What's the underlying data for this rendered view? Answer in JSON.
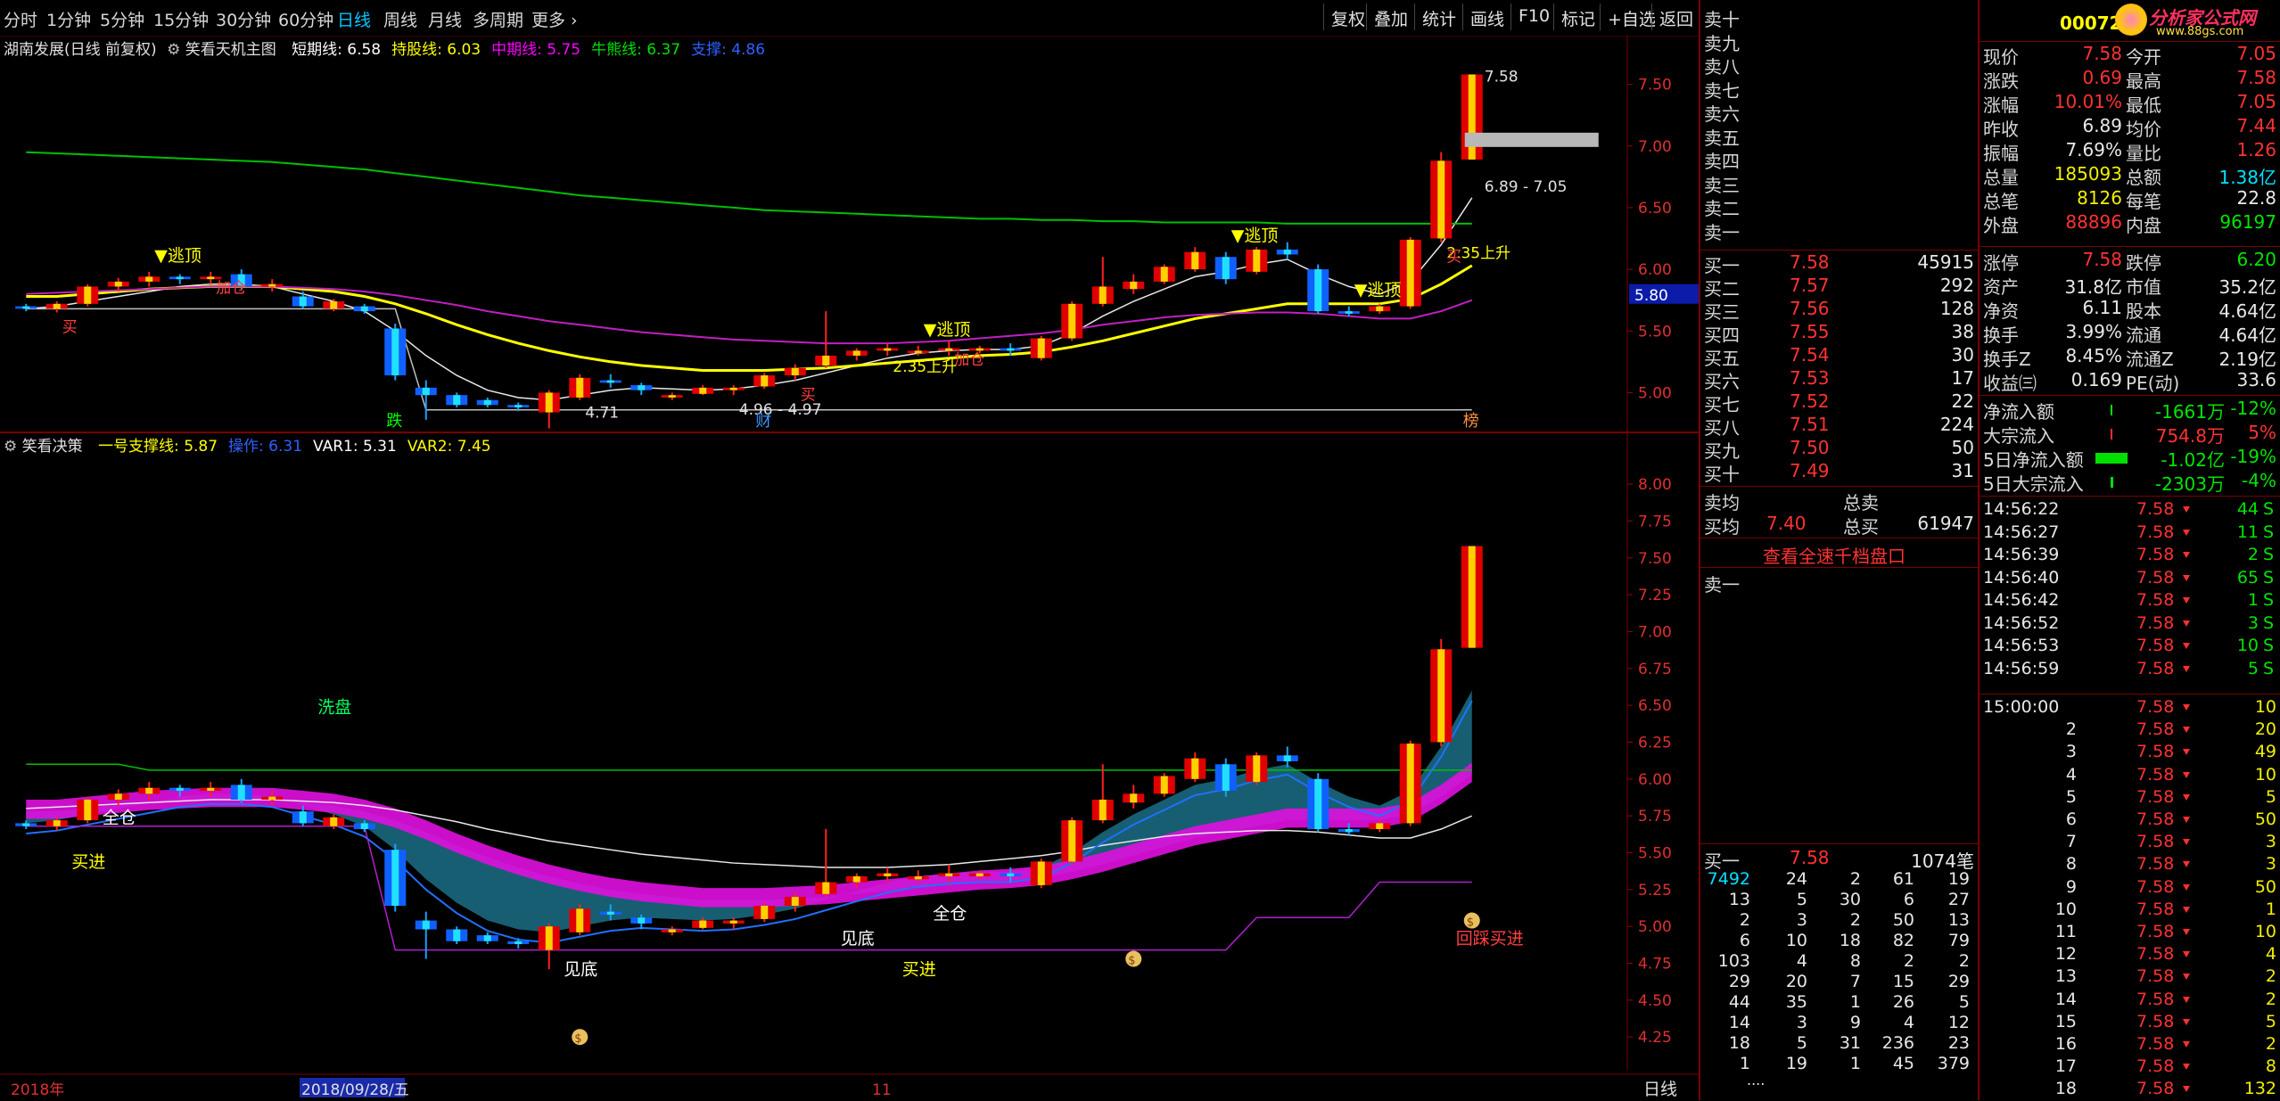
{
  "toolbar": {
    "periods": [
      "分时",
      "1分钟",
      "5分钟",
      "15分钟",
      "30分钟",
      "60分钟",
      "日线",
      "周线",
      "月线",
      "多周期",
      "更多"
    ],
    "active_period": "日线",
    "buttons": [
      "复权",
      "叠加",
      "统计",
      "画线",
      "F10",
      "标记",
      "+自选",
      "返回"
    ]
  },
  "main_legend": {
    "stock": "湖南发展(日线 前复权)",
    "indicator": "笑看天机主图",
    "items": [
      {
        "label": "短期线: 6.58",
        "color": "#ffffff"
      },
      {
        "label": "持股线: 6.03",
        "color": "#ffff00"
      },
      {
        "label": "中期线: 5.75",
        "color": "#ff00ff"
      },
      {
        "label": "牛熊线: 6.37",
        "color": "#00e000"
      },
      {
        "label": "支撑: 4.86",
        "color": "#3060ff"
      }
    ]
  },
  "sub_legend": {
    "indicator": "笑看决策",
    "items": [
      {
        "label": "一号支撑线: 5.87",
        "color": "#ffff00"
      },
      {
        "label": "操作: 6.31",
        "color": "#3060ff"
      },
      {
        "label": "VAR1: 5.31",
        "color": "#ffffff"
      },
      {
        "label": "VAR2: 7.45",
        "color": "#ffff00"
      }
    ]
  },
  "chart_data": [
    {
      "type": "candlestick",
      "title": "湖南发展(日线 前复权)",
      "ylim": [
        4.75,
        7.75
      ],
      "y_ticks": [
        "7.50",
        "7.00",
        "6.50",
        "6.00",
        "5.50",
        "5.00"
      ],
      "price_tag": "5.80",
      "candles": [
        [
          5.7,
          5.72,
          5.66,
          5.68
        ],
        [
          5.68,
          5.74,
          5.65,
          5.72
        ],
        [
          5.72,
          5.88,
          5.7,
          5.86
        ],
        [
          5.86,
          5.93,
          5.82,
          5.9
        ],
        [
          5.9,
          5.98,
          5.86,
          5.94
        ],
        [
          5.94,
          5.96,
          5.88,
          5.92
        ],
        [
          5.92,
          5.98,
          5.88,
          5.94
        ],
        [
          5.96,
          6.0,
          5.84,
          5.86
        ],
        [
          5.86,
          5.92,
          5.82,
          5.88
        ],
        [
          5.78,
          5.82,
          5.68,
          5.7
        ],
        [
          5.68,
          5.76,
          5.66,
          5.74
        ],
        [
          5.7,
          5.72,
          5.64,
          5.66
        ],
        [
          5.52,
          5.56,
          5.1,
          5.14
        ],
        [
          5.04,
          5.1,
          4.78,
          4.98
        ],
        [
          4.98,
          5.0,
          4.88,
          4.9
        ],
        [
          4.94,
          4.96,
          4.88,
          4.9
        ],
        [
          4.9,
          4.92,
          4.85,
          4.88
        ],
        [
          4.84,
          5.02,
          4.71,
          5.0
        ],
        [
          4.96,
          5.15,
          4.94,
          5.12
        ],
        [
          5.1,
          5.15,
          5.04,
          5.08
        ],
        [
          5.06,
          5.08,
          4.98,
          5.02
        ],
        [
          4.96,
          5.0,
          4.94,
          4.98
        ],
        [
          4.99,
          5.06,
          4.98,
          5.04
        ],
        [
          5.02,
          5.06,
          4.98,
          5.04
        ],
        [
          5.05,
          5.16,
          5.03,
          5.14
        ],
        [
          5.14,
          5.23,
          5.1,
          5.2
        ],
        [
          5.22,
          5.66,
          5.2,
          5.3
        ],
        [
          5.3,
          5.36,
          5.26,
          5.34
        ],
        [
          5.34,
          5.4,
          5.3,
          5.36
        ],
        [
          5.32,
          5.38,
          5.3,
          5.34
        ],
        [
          5.34,
          5.42,
          5.3,
          5.36
        ],
        [
          5.34,
          5.38,
          5.32,
          5.36
        ],
        [
          5.36,
          5.4,
          5.3,
          5.34
        ],
        [
          5.28,
          5.46,
          5.26,
          5.44
        ],
        [
          5.44,
          5.74,
          5.42,
          5.72
        ],
        [
          5.72,
          6.1,
          5.7,
          5.86
        ],
        [
          5.84,
          5.96,
          5.8,
          5.9
        ],
        [
          5.9,
          6.04,
          5.88,
          6.02
        ],
        [
          6.0,
          6.18,
          5.98,
          6.14
        ],
        [
          6.1,
          6.14,
          5.88,
          5.92
        ],
        [
          5.98,
          6.18,
          5.96,
          6.16
        ],
        [
          6.16,
          6.22,
          6.08,
          6.12
        ],
        [
          6.0,
          6.04,
          5.64,
          5.66
        ],
        [
          5.66,
          5.7,
          5.62,
          5.64
        ],
        [
          5.66,
          5.72,
          5.64,
          5.7
        ],
        [
          5.7,
          6.26,
          5.68,
          6.24
        ],
        [
          6.25,
          6.95,
          6.22,
          6.88
        ],
        [
          6.89,
          7.58,
          6.89,
          7.58
        ]
      ],
      "lines": {
        "短期线": [
          5.68,
          5.7,
          5.74,
          5.78,
          5.82,
          5.86,
          5.88,
          5.88,
          5.86,
          5.8,
          5.74,
          5.66,
          5.5,
          5.3,
          5.14,
          5.02,
          4.96,
          4.94,
          4.98,
          5.02,
          5.04,
          5.03,
          5.02,
          5.03,
          5.06,
          5.1,
          5.16,
          5.22,
          5.28,
          5.32,
          5.34,
          5.35,
          5.35,
          5.38,
          5.48,
          5.62,
          5.74,
          5.84,
          5.94,
          5.98,
          6.04,
          6.08,
          5.96,
          5.86,
          5.8,
          5.9,
          6.2,
          6.58
        ],
        "持股线": [
          5.78,
          5.78,
          5.8,
          5.82,
          5.84,
          5.85,
          5.86,
          5.86,
          5.86,
          5.84,
          5.82,
          5.78,
          5.72,
          5.64,
          5.55,
          5.47,
          5.4,
          5.34,
          5.29,
          5.25,
          5.22,
          5.2,
          5.18,
          5.18,
          5.18,
          5.19,
          5.2,
          5.22,
          5.24,
          5.26,
          5.28,
          5.3,
          5.31,
          5.33,
          5.37,
          5.42,
          5.48,
          5.54,
          5.6,
          5.64,
          5.68,
          5.72,
          5.72,
          5.72,
          5.72,
          5.76,
          5.88,
          6.03
        ],
        "中期线": [
          5.8,
          5.81,
          5.82,
          5.83,
          5.84,
          5.85,
          5.86,
          5.86,
          5.86,
          5.85,
          5.84,
          5.82,
          5.79,
          5.75,
          5.71,
          5.66,
          5.62,
          5.58,
          5.55,
          5.52,
          5.49,
          5.47,
          5.45,
          5.43,
          5.42,
          5.41,
          5.4,
          5.4,
          5.4,
          5.41,
          5.42,
          5.44,
          5.46,
          5.48,
          5.51,
          5.55,
          5.58,
          5.61,
          5.63,
          5.64,
          5.65,
          5.65,
          5.64,
          5.62,
          5.6,
          5.6,
          5.66,
          5.75
        ],
        "牛熊线": [
          6.95,
          6.94,
          6.93,
          6.92,
          6.91,
          6.9,
          6.89,
          6.88,
          6.87,
          6.85,
          6.83,
          6.81,
          6.78,
          6.75,
          6.72,
          6.69,
          6.66,
          6.63,
          6.6,
          6.58,
          6.56,
          6.54,
          6.52,
          6.5,
          6.48,
          6.47,
          6.46,
          6.45,
          6.44,
          6.43,
          6.42,
          6.41,
          6.41,
          6.4,
          6.4,
          6.39,
          6.39,
          6.38,
          6.38,
          6.38,
          6.38,
          6.37,
          6.37,
          6.37,
          6.37,
          6.37,
          6.37,
          6.37
        ],
        "支撑": [
          5.68,
          5.68,
          5.68,
          5.68,
          5.68,
          5.68,
          5.68,
          5.68,
          5.68,
          5.68,
          5.68,
          5.68,
          5.68,
          4.86,
          4.86,
          4.86,
          4.86,
          4.86,
          4.86,
          4.86,
          4.86,
          4.86,
          4.86,
          4.86,
          4.86,
          4.86,
          4.86,
          4.86,
          4.86,
          4.86,
          4.86,
          4.86,
          4.86,
          4.86,
          4.86,
          4.86,
          4.86,
          4.86,
          4.86,
          4.86,
          4.86,
          4.86,
          4.86,
          4.86,
          4.86,
          4.86,
          4.86,
          4.86
        ]
      },
      "annotations": [
        {
          "i": 4,
          "text": "▼逃顶",
          "color": "#ffff00"
        },
        {
          "i": 1,
          "text": "买",
          "color": "#ff4040"
        },
        {
          "i": 6,
          "text": "加仓",
          "color": "#ff4040"
        },
        {
          "i": 29,
          "text": "▼逃顶",
          "color": "#ffff00"
        },
        {
          "i": 39,
          "text": "▼逃顶",
          "color": "#ffff00"
        },
        {
          "i": 43,
          "text": "▼逃顶",
          "color": "#ffff00"
        },
        {
          "i": 30,
          "text": "加仓",
          "color": "#ff4040"
        },
        {
          "i": 28,
          "text": "2.35上升",
          "color": "#ffff00"
        },
        {
          "i": 25,
          "text": "买",
          "color": "#ff4040"
        },
        {
          "i": 46,
          "text": "2.35上升",
          "color": "#ffff00"
        },
        {
          "i": 46,
          "text": "买",
          "color": "#ff4040"
        },
        {
          "i": 47,
          "text": "7.58",
          "color": "#e0e0e0"
        },
        {
          "i": 18,
          "text": "4.71",
          "color": "#e0e0e0"
        },
        {
          "i": 23,
          "text": "4.96 - 4.97",
          "color": "#e0e0e0"
        },
        {
          "i": 47,
          "text": "6.89 - 7.05",
          "color": "#e0e0e0"
        }
      ],
      "markers": [
        {
          "i": 12,
          "text": "跌",
          "color": "#00ff00"
        },
        {
          "i": 24,
          "text": "财",
          "color": "#3c96ff"
        },
        {
          "i": 47,
          "text": "榜",
          "color": "#ff9040"
        }
      ]
    },
    {
      "type": "candlestick",
      "title": "笑看决策",
      "ylim": [
        4.1,
        8.2
      ],
      "y_ticks": [
        "8.00",
        "7.75",
        "7.50",
        "7.25",
        "7.00",
        "6.75",
        "6.50",
        "6.25",
        "6.00",
        "5.75",
        "5.50",
        "5.25",
        "5.00",
        "4.75",
        "4.50",
        "4.25"
      ],
      "text_labels": [
        {
          "i": 10,
          "y": 6.45,
          "text": "洗盘",
          "color": "#00ff60"
        },
        {
          "i": 3,
          "y": 5.7,
          "text": "全仓",
          "color": "#ffffff"
        },
        {
          "i": 2,
          "y": 5.4,
          "text": "买进",
          "color": "#ffff00"
        },
        {
          "i": 18,
          "y": 4.67,
          "text": "见底",
          "color": "#ffffff"
        },
        {
          "i": 27,
          "y": 4.88,
          "text": "见底",
          "color": "#ffffff"
        },
        {
          "i": 29,
          "y": 4.67,
          "text": "买进",
          "color": "#ffff00"
        },
        {
          "i": 30,
          "y": 5.05,
          "text": "全仓",
          "color": "#ffffff"
        },
        {
          "i": 47,
          "y": 4.88,
          "text": "回踩买进",
          "color": "#ff4040"
        }
      ],
      "money_icons": [
        {
          "i": 18,
          "y": 4.25
        },
        {
          "i": 36,
          "y": 4.78
        },
        {
          "i": 47,
          "y": 5.04
        }
      ]
    }
  ],
  "time_axis": {
    "labels": [
      "2018年",
      "2018/09/28/五",
      "11"
    ],
    "period_button": "日线"
  },
  "quote": {
    "code": "000722",
    "logo": "分析家公式网",
    "logo_url_text": "www.88gs.com",
    "sell_labels": [
      "卖十",
      "卖九",
      "卖八",
      "卖七",
      "卖六",
      "卖五",
      "卖四",
      "卖三",
      "卖二",
      "卖一"
    ],
    "buy_levels": [
      {
        "label": "买一",
        "price": "7.58",
        "vol": "45915"
      },
      {
        "label": "买二",
        "price": "7.57",
        "vol": "292"
      },
      {
        "label": "买三",
        "price": "7.56",
        "vol": "128"
      },
      {
        "label": "买四",
        "price": "7.55",
        "vol": "38"
      },
      {
        "label": "买五",
        "price": "7.54",
        "vol": "30"
      },
      {
        "label": "买六",
        "price": "7.53",
        "vol": "17"
      },
      {
        "label": "买七",
        "price": "7.52",
        "vol": "22"
      },
      {
        "label": "买八",
        "price": "7.51",
        "vol": "224"
      },
      {
        "label": "买九",
        "price": "7.50",
        "vol": "50"
      },
      {
        "label": "买十",
        "price": "7.49",
        "vol": "31"
      }
    ],
    "avg": {
      "sell_label": "卖均",
      "sell_total_label": "总卖",
      "buy_label": "买均",
      "buy_price": "7.40",
      "buy_total_label": "总买",
      "buy_total": "61947"
    },
    "full_queue_link": "查看全速千档盘口",
    "sell_one_queue_label": "卖一",
    "buy_one_queue": {
      "label": "买一",
      "price": "7.58",
      "total": "1074笔"
    },
    "queue_rows": [
      [
        "7492",
        "24",
        "2",
        "61",
        "19"
      ],
      [
        "13",
        "5",
        "30",
        "6",
        "27"
      ],
      [
        "2",
        "3",
        "2",
        "50",
        "13"
      ],
      [
        "6",
        "10",
        "18",
        "82",
        "79"
      ],
      [
        "103",
        "4",
        "8",
        "2",
        "2"
      ],
      [
        "29",
        "20",
        "7",
        "15",
        "29"
      ],
      [
        "44",
        "35",
        "1",
        "26",
        "5"
      ],
      [
        "14",
        "3",
        "9",
        "4",
        "12"
      ],
      [
        "18",
        "5",
        "31",
        "236",
        "23"
      ],
      [
        "1",
        "19",
        "1",
        "45",
        "379"
      ]
    ],
    "queue_more": "....",
    "stats": [
      [
        "现价",
        "7.58",
        "今开",
        "7.05"
      ],
      [
        "涨跌",
        "0.69",
        "最高",
        "7.58"
      ],
      [
        "涨幅",
        "10.01%",
        "最低",
        "7.05"
      ],
      [
        "昨收",
        "6.89",
        "均价",
        "7.44"
      ],
      [
        "振幅",
        "7.69%",
        "量比",
        "1.26"
      ],
      [
        "总量",
        "185093",
        "总额",
        "1.38亿"
      ],
      [
        "总笔",
        "8126",
        "每笔",
        "22.8"
      ],
      [
        "外盘",
        "88896",
        "内盘",
        "96197"
      ]
    ],
    "stats2": [
      [
        "涨停",
        "7.58",
        "跌停",
        "6.20"
      ],
      [
        "资产",
        "31.8亿",
        "市值",
        "35.2亿"
      ],
      [
        "净资",
        "6.11",
        "股本",
        "4.64亿"
      ],
      [
        "换手",
        "3.99%",
        "流通",
        "4.64亿"
      ],
      [
        "换手Z",
        "8.45%",
        "流通Z",
        "2.19亿"
      ],
      [
        "收益㈢",
        "0.169",
        "PE(动)",
        "33.6"
      ]
    ],
    "flows": [
      {
        "label": "净流入额",
        "value": "-1661万",
        "pct": "-12%",
        "bar": 0.02
      },
      {
        "label": "大宗流入",
        "value": "754.8万",
        "pct": "5%",
        "bar": 0.01
      },
      {
        "label": "5日净流入额",
        "value": "-1.02亿",
        "pct": "-19%",
        "bar": 0.6
      },
      {
        "label": "5日大宗流入",
        "value": "-2303万",
        "pct": "-4%",
        "bar": 0.05
      }
    ],
    "ticks": [
      [
        "14:56:22",
        "7.58",
        "44",
        "S"
      ],
      [
        "14:56:27",
        "7.58",
        "11",
        "S"
      ],
      [
        "14:56:39",
        "7.58",
        "2",
        "S"
      ],
      [
        "14:56:40",
        "7.58",
        "65",
        "S"
      ],
      [
        "14:56:42",
        "7.58",
        "1",
        "S"
      ],
      [
        "14:56:52",
        "7.58",
        "3",
        "S"
      ],
      [
        "14:56:53",
        "7.58",
        "10",
        "S"
      ],
      [
        "14:56:59",
        "7.58",
        "5",
        "S"
      ]
    ],
    "close_ticks": [
      [
        "15:00:00",
        "7.58",
        "10"
      ],
      [
        "2",
        "7.58",
        "20"
      ],
      [
        "3",
        "7.58",
        "49"
      ],
      [
        "4",
        "7.58",
        "10"
      ],
      [
        "5",
        "7.58",
        "5"
      ],
      [
        "6",
        "7.58",
        "50"
      ],
      [
        "7",
        "7.58",
        "3"
      ],
      [
        "8",
        "7.58",
        "3"
      ],
      [
        "9",
        "7.58",
        "50"
      ],
      [
        "10",
        "7.58",
        "1"
      ],
      [
        "11",
        "7.58",
        "10"
      ],
      [
        "12",
        "7.58",
        "4"
      ],
      [
        "13",
        "7.58",
        "2"
      ],
      [
        "14",
        "7.58",
        "2"
      ],
      [
        "15",
        "7.58",
        "5"
      ],
      [
        "16",
        "7.58",
        "2"
      ],
      [
        "17",
        "7.58",
        "8"
      ],
      [
        "18",
        "7.58",
        "132"
      ]
    ]
  }
}
